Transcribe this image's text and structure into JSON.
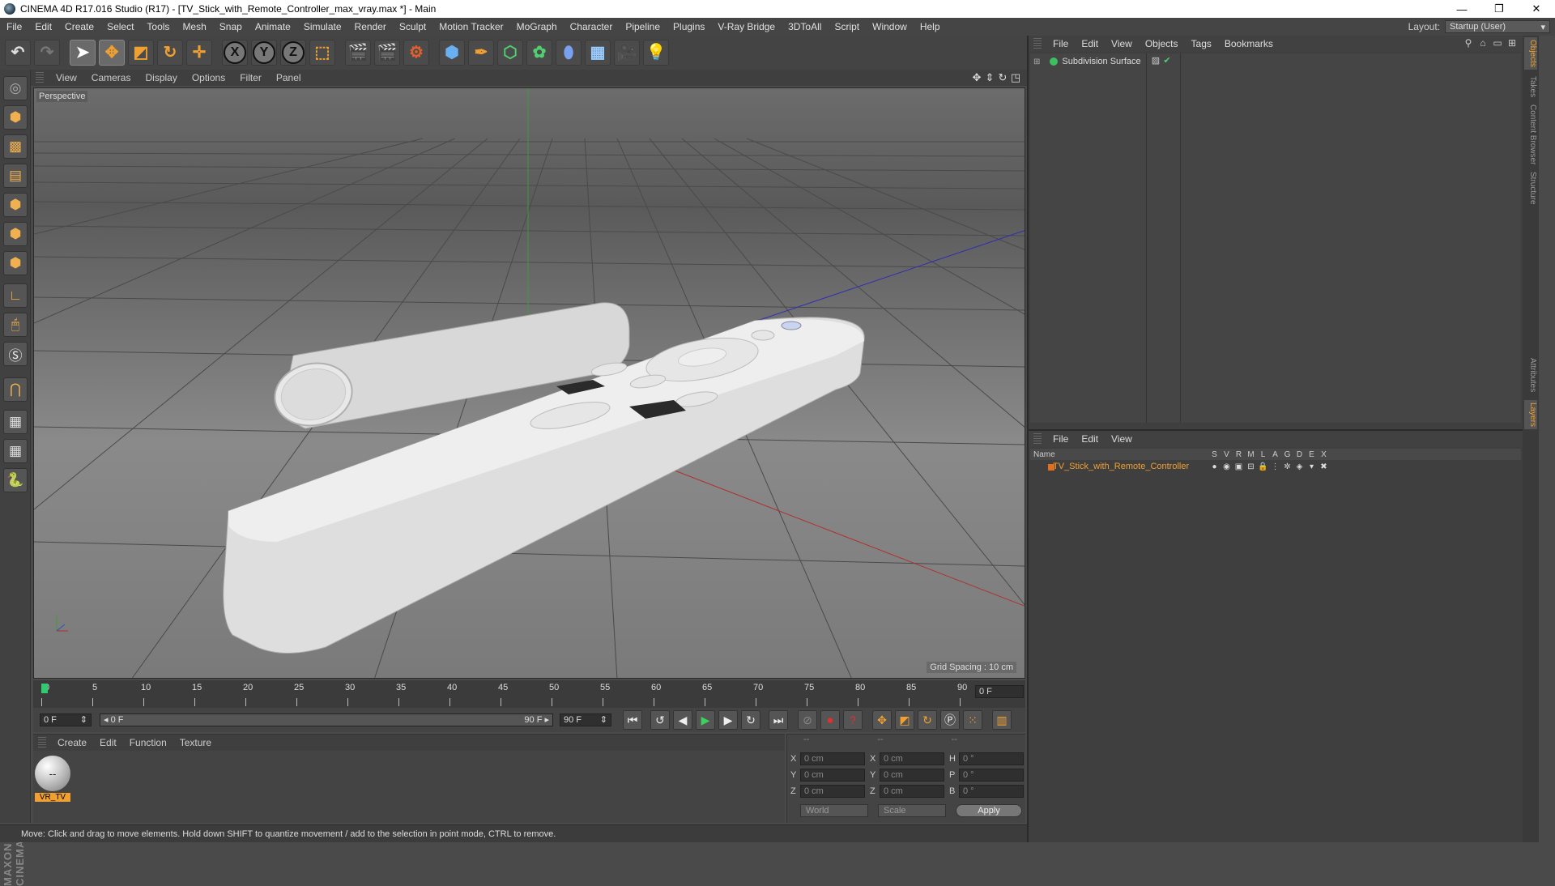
{
  "titlebar": {
    "title": "CINEMA 4D R17.016 Studio (R17) - [TV_Stick_with_Remote_Controller_max_vray.max *] - Main",
    "minimize": "—",
    "restore": "❐",
    "close": "✕"
  },
  "menu": [
    "File",
    "Edit",
    "Create",
    "Select",
    "Tools",
    "Mesh",
    "Snap",
    "Animate",
    "Simulate",
    "Render",
    "Sculpt",
    "Motion Tracker",
    "MoGraph",
    "Character",
    "Pipeline",
    "Plugins",
    "V-Ray Bridge",
    "3DToAll",
    "Script",
    "Window",
    "Help"
  ],
  "layout": {
    "label": "Layout:",
    "value": "Startup (User)"
  },
  "viewport": {
    "menu": [
      "View",
      "Cameras",
      "Display",
      "Options",
      "Filter",
      "Panel"
    ],
    "label": "Perspective",
    "grid_spacing": "Grid Spacing : 10 cm"
  },
  "timeline": {
    "ticks": [
      "0",
      "5",
      "10",
      "15",
      "20",
      "25",
      "30",
      "35",
      "40",
      "45",
      "50",
      "55",
      "60",
      "65",
      "70",
      "75",
      "80",
      "85",
      "90"
    ],
    "end_field": "0 F",
    "start_field": "0 F",
    "range_start": "◂ 0 F",
    "range_end": "90 F ▸",
    "max_field": "90 F"
  },
  "materials": {
    "menu": [
      "Create",
      "Edit",
      "Function",
      "Texture"
    ],
    "items": [
      {
        "name": "VR_TV",
        "glyph": "--"
      }
    ]
  },
  "coords": {
    "headers": [
      "--",
      "--",
      "--"
    ],
    "rows": [
      {
        "a1": "X",
        "v1": "0 cm",
        "a2": "X",
        "v2": "0 cm",
        "a3": "H",
        "v3": "0 °"
      },
      {
        "a1": "Y",
        "v1": "0 cm",
        "a2": "Y",
        "v2": "0 cm",
        "a3": "P",
        "v3": "0 °"
      },
      {
        "a1": "Z",
        "v1": "0 cm",
        "a2": "Z",
        "v2": "0 cm",
        "a3": "B",
        "v3": "0 °"
      }
    ],
    "mode1": "World",
    "mode2": "Scale",
    "apply": "Apply"
  },
  "status": "Move: Click and drag to move elements. Hold down SHIFT to quantize movement / add to the selection in point mode, CTRL to remove.",
  "object_manager": {
    "menu": [
      "File",
      "Edit",
      "View",
      "Objects",
      "Tags",
      "Bookmarks"
    ],
    "objects": [
      {
        "name": "Subdivision Surface"
      }
    ]
  },
  "layer_manager": {
    "menu": [
      "File",
      "Edit",
      "View"
    ],
    "columns": [
      "Name",
      "S",
      "V",
      "R",
      "M",
      "L",
      "A",
      "G",
      "D",
      "E",
      "X"
    ],
    "layers": [
      {
        "name": "TV_Stick_with_Remote_Controller"
      }
    ]
  },
  "side_tabs": [
    "Objects",
    "Takes",
    "Content Browser",
    "Structure",
    "Attributes",
    "Layers"
  ],
  "brand": "MAXON CINEMA4D"
}
